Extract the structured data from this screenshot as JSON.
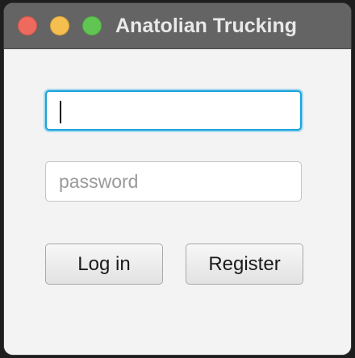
{
  "window": {
    "title": "Anatolian Trucking"
  },
  "form": {
    "username_value": "",
    "password_placeholder": "password",
    "login_label": "Log in",
    "register_label": "Register"
  },
  "colors": {
    "titlebar": "#646464",
    "close": "#ee6a5e",
    "minimize": "#f5bf4f",
    "zoom": "#61c554",
    "focus_ring": "#1aa3d9"
  }
}
